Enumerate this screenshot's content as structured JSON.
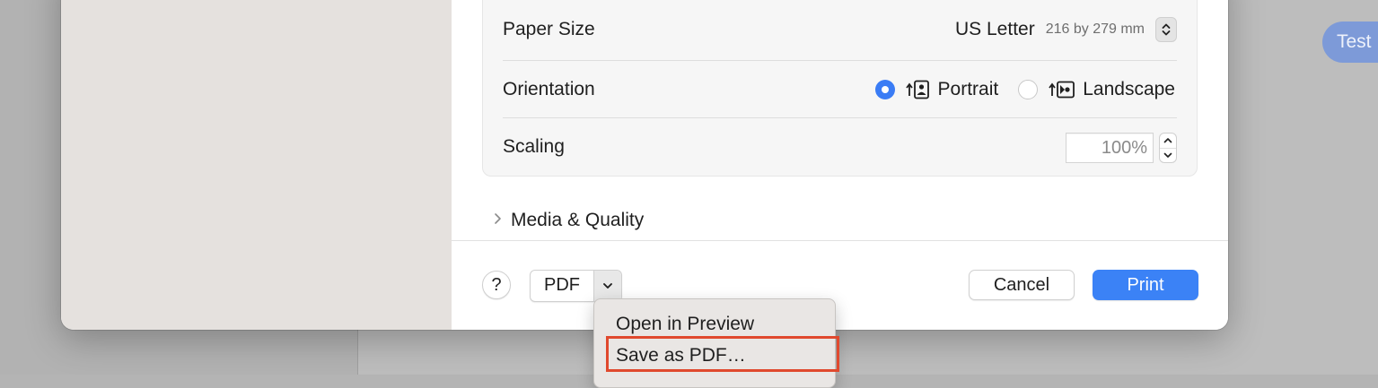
{
  "background": {
    "test_label": "Test"
  },
  "settings": {
    "paper_size": {
      "label": "Paper Size",
      "value": "US Letter",
      "dimensions": "216 by 279 mm"
    },
    "orientation": {
      "label": "Orientation",
      "options": [
        {
          "label": "Portrait",
          "selected": true
        },
        {
          "label": "Landscape",
          "selected": false
        }
      ]
    },
    "scaling": {
      "label": "Scaling",
      "value": "100%"
    },
    "media_quality": {
      "label": "Media & Quality",
      "expanded": false
    }
  },
  "footer": {
    "help_label": "?",
    "pdf_label": "PDF",
    "cancel_label": "Cancel",
    "print_label": "Print"
  },
  "pdf_menu": {
    "items": [
      {
        "label": "Open in Preview"
      },
      {
        "label": "Save as PDF…",
        "highlighted": true
      }
    ]
  },
  "colors": {
    "accent": "#3b82f6",
    "highlight_outline": "#e0492e",
    "preview_background": "#e5e1de"
  }
}
